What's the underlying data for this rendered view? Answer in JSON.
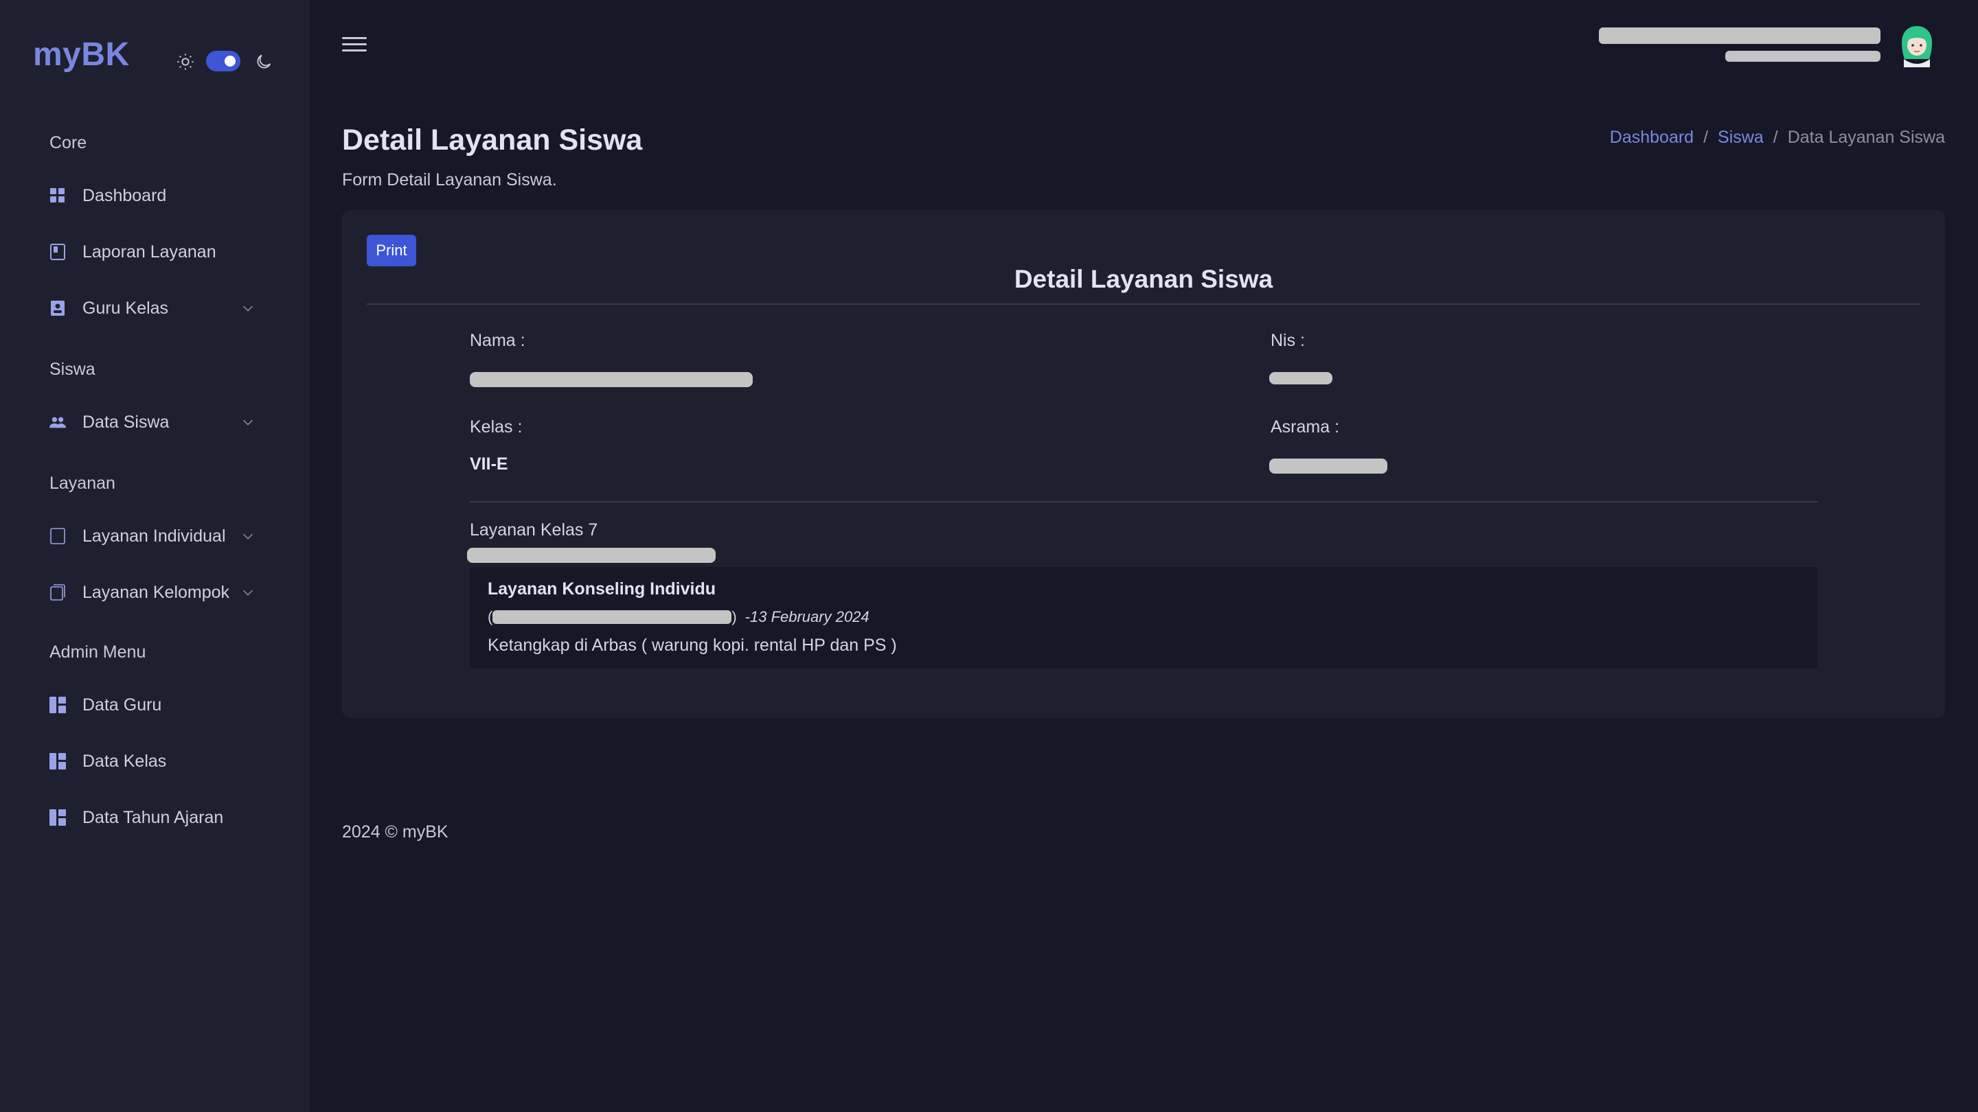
{
  "app": {
    "brand": "myBK"
  },
  "theme": {
    "accent": "#3d55d6",
    "brand_color": "#7b86e0"
  },
  "sidebar": {
    "sections": [
      {
        "heading": "Core"
      },
      {
        "heading": "Siswa"
      },
      {
        "heading": "Layanan"
      },
      {
        "heading": "Admin Menu"
      }
    ],
    "items": [
      {
        "label": "Dashboard",
        "icon": "dashboard-icon"
      },
      {
        "label": "Laporan Layanan",
        "icon": "report-icon"
      },
      {
        "label": "Guru Kelas",
        "icon": "teacher-icon"
      },
      {
        "label": "Data Siswa",
        "icon": "users-icon"
      },
      {
        "label": "Layanan Individual",
        "icon": "square-icon"
      },
      {
        "label": "Layanan Kelompok",
        "icon": "copy-icon"
      },
      {
        "label": "Data Guru",
        "icon": "grid-icon"
      },
      {
        "label": "Data Kelas",
        "icon": "grid-icon"
      },
      {
        "label": "Data Tahun Ajaran",
        "icon": "grid-icon"
      }
    ]
  },
  "header": {
    "title": "Detail Layanan Siswa",
    "subtitle": "Form Detail Layanan Siswa.",
    "breadcrumb": [
      "Dashboard",
      "Siswa",
      "Data Layanan Siswa"
    ]
  },
  "card": {
    "print_label": "Print",
    "title": "Detail Layanan Siswa",
    "fields": {
      "nama_label": "Nama :",
      "nis_label": "Nis :",
      "kelas_label": "Kelas :",
      "kelas_value": "VII-E",
      "asrama_label": "Asrama :"
    },
    "section_title": "Layanan Kelas 7",
    "service": {
      "name": "Layanan Konseling Individu",
      "paren_open": "(",
      "paren_close": ")",
      "date": "-13 February 2024",
      "description": "Ketangkap di Arbas ( warung kopi. rental HP dan PS )"
    }
  },
  "footer": {
    "text": "2024 © myBK"
  }
}
